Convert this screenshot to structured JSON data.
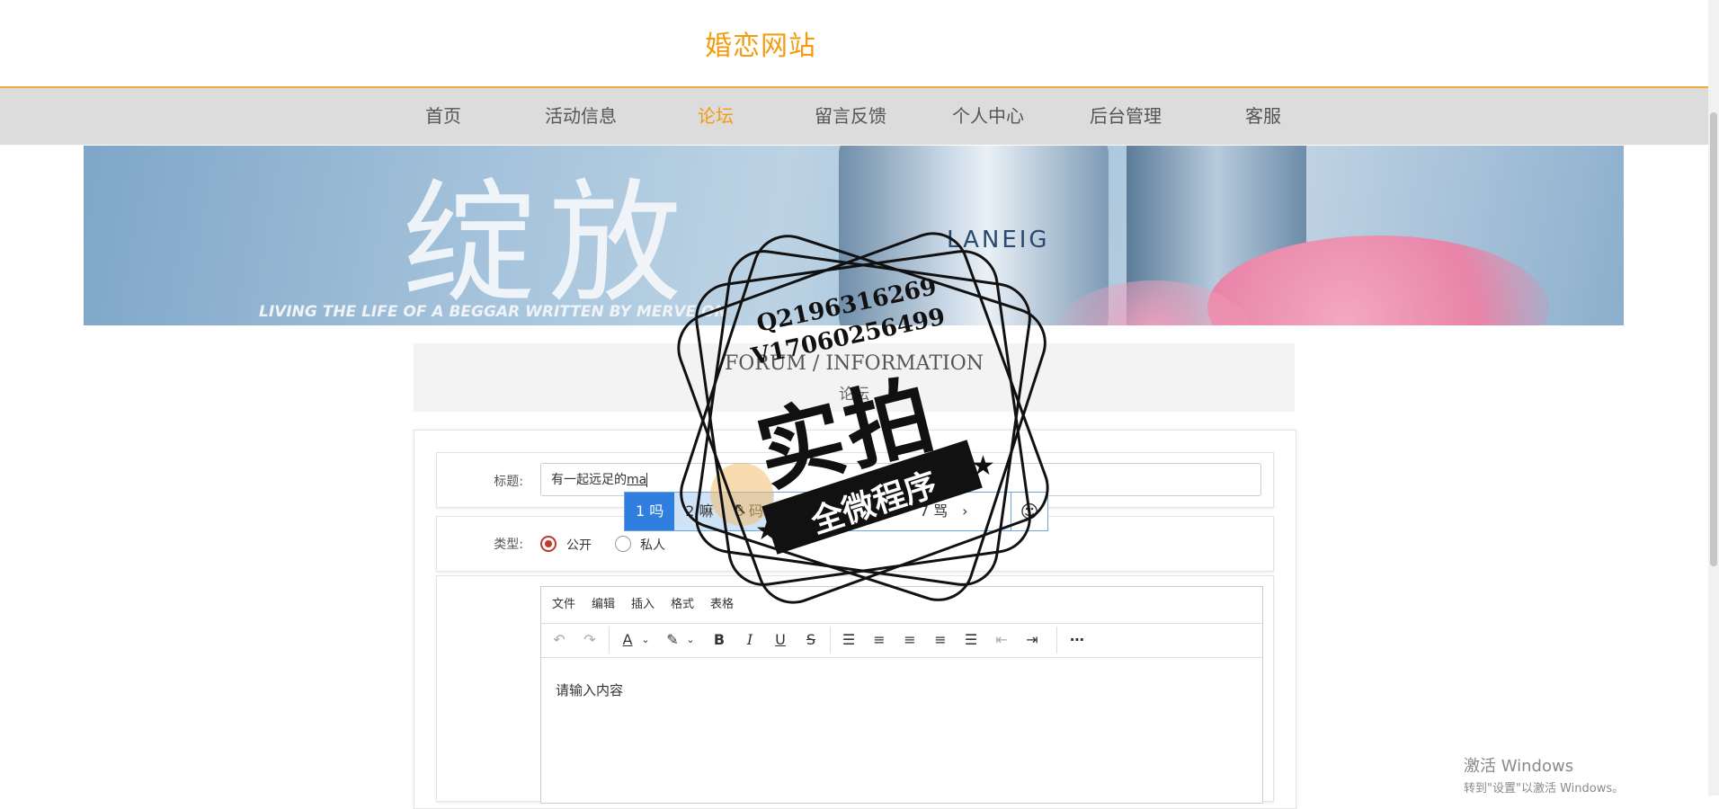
{
  "site": {
    "title": "婚恋网站"
  },
  "nav": {
    "items": [
      {
        "label": "首页"
      },
      {
        "label": "活动信息"
      },
      {
        "label": "论坛",
        "active": true
      },
      {
        "label": "留言反馈"
      },
      {
        "label": "个人中心"
      },
      {
        "label": "后台管理"
      },
      {
        "label": "客服"
      }
    ],
    "active_color": "#f39c12"
  },
  "banner": {
    "headline": "绽放",
    "tagline": "LIVING THE LIFE OF A BEGGAR WRITTEN BY MERVE ON",
    "product_label": "LANEIG"
  },
  "section": {
    "title_en": "FORUM / INFORMATION",
    "title_cn": "论坛"
  },
  "form": {
    "title_label": "标题:",
    "title_value_committed": "有一起远足的",
    "title_value_composing": "ma",
    "type_label": "类型:",
    "type_options": [
      {
        "label": "公开",
        "checked": true
      },
      {
        "label": "私人",
        "checked": false
      }
    ]
  },
  "ime": {
    "candidates": [
      {
        "text": "1 吗",
        "state": "selected"
      },
      {
        "text": "2 嘛",
        "state": "hover"
      },
      {
        "text": "3 码",
        "state": "hover"
      },
      {
        "text": "7 骂",
        "state": "normal"
      }
    ],
    "next_glyph": "›",
    "emoji_glyph": "☺"
  },
  "editor": {
    "menu": [
      "文件",
      "编辑",
      "插入",
      "格式",
      "表格"
    ],
    "toolbar_icons": [
      "undo-icon",
      "redo-icon",
      "font-color-icon",
      "highlight-icon",
      "bold-icon",
      "italic-icon",
      "underline-icon",
      "strikethrough-icon",
      "line-height-icon",
      "align-left-icon",
      "align-center-icon",
      "align-right-icon",
      "justify-icon",
      "outdent-icon",
      "indent-icon",
      "more-icon"
    ],
    "placeholder": "请输入内容"
  },
  "stamp": {
    "line1": "Q2196316269",
    "line2": "V17060256499",
    "big": "实拍",
    "ribbon": "全微程序"
  },
  "os_watermark": {
    "line1": "激活 Windows",
    "line2": "转到\"设置\"以激活 Windows。"
  }
}
